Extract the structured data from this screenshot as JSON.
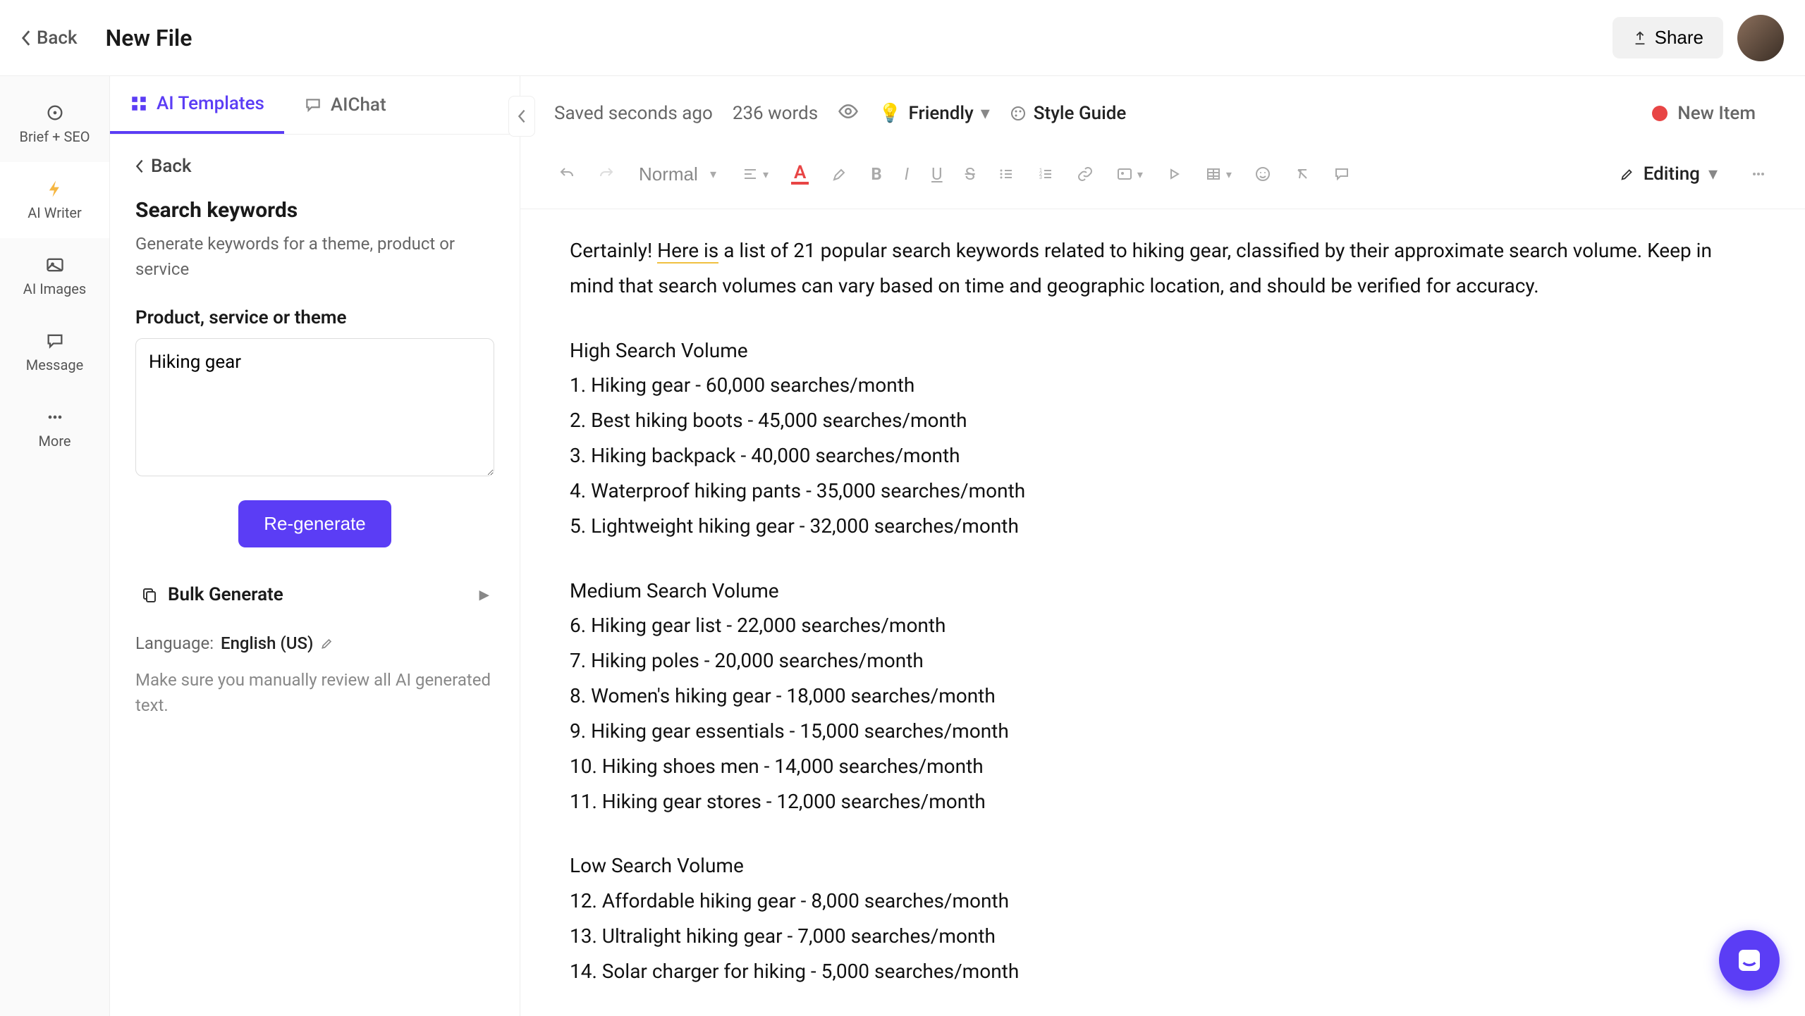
{
  "header": {
    "back": "Back",
    "file_title": "New File",
    "share": "Share"
  },
  "nav": {
    "items": [
      {
        "label": "Brief + SEO"
      },
      {
        "label": "AI Writer"
      },
      {
        "label": "AI Images"
      },
      {
        "label": "Message"
      },
      {
        "label": "More"
      }
    ]
  },
  "sidebar": {
    "tabs": [
      {
        "label": "AI Templates"
      },
      {
        "label": "AIChat"
      }
    ],
    "back": "Back",
    "title": "Search keywords",
    "description": "Generate keywords for a theme, product or service",
    "field_label": "Product, service or theme",
    "field_value": "Hiking gear",
    "regenerate": "Re-generate",
    "bulk": "Bulk Generate",
    "language_label": "Language:",
    "language_value": "English (US)",
    "disclaimer": "Make sure you manually review all AI generated text."
  },
  "editor_top": {
    "saved": "Saved seconds ago",
    "word_count": "236 words",
    "tone": "Friendly",
    "style_guide": "Style Guide",
    "new_item": "New Item"
  },
  "toolbar": {
    "para": "Normal",
    "mode": "Editing"
  },
  "document": {
    "intro_prefix": "Certainly! ",
    "intro_link": "Here is",
    "intro_rest": " a list of 21 popular search keywords related to hiking gear, classified by their approximate search volume. Keep in mind that search volumes can vary based on time and geographic location, and should be verified for accuracy.",
    "section1": "High Search Volume",
    "lines1": [
      "1. Hiking gear - 60,000 searches/month",
      "2. Best hiking boots - 45,000 searches/month",
      "3. Hiking backpack - 40,000 searches/month",
      "4. Waterproof hiking pants - 35,000 searches/month",
      "5. Lightweight hiking gear - 32,000 searches/month"
    ],
    "section2": "Medium Search Volume",
    "lines2": [
      "6. Hiking gear list - 22,000 searches/month",
      "7. Hiking poles - 20,000 searches/month",
      "8. Women's hiking gear - 18,000 searches/month",
      "9. Hiking gear essentials - 15,000 searches/month",
      "10. Hiking shoes men - 14,000 searches/month",
      "11. Hiking gear stores - 12,000 searches/month"
    ],
    "section3": "Low Search Volume",
    "lines3": [
      "12. Affordable hiking gear - 8,000 searches/month",
      "13. Ultralight hiking gear - 7,000 searches/month",
      "14. Solar charger for hiking - 5,000 searches/month"
    ]
  }
}
